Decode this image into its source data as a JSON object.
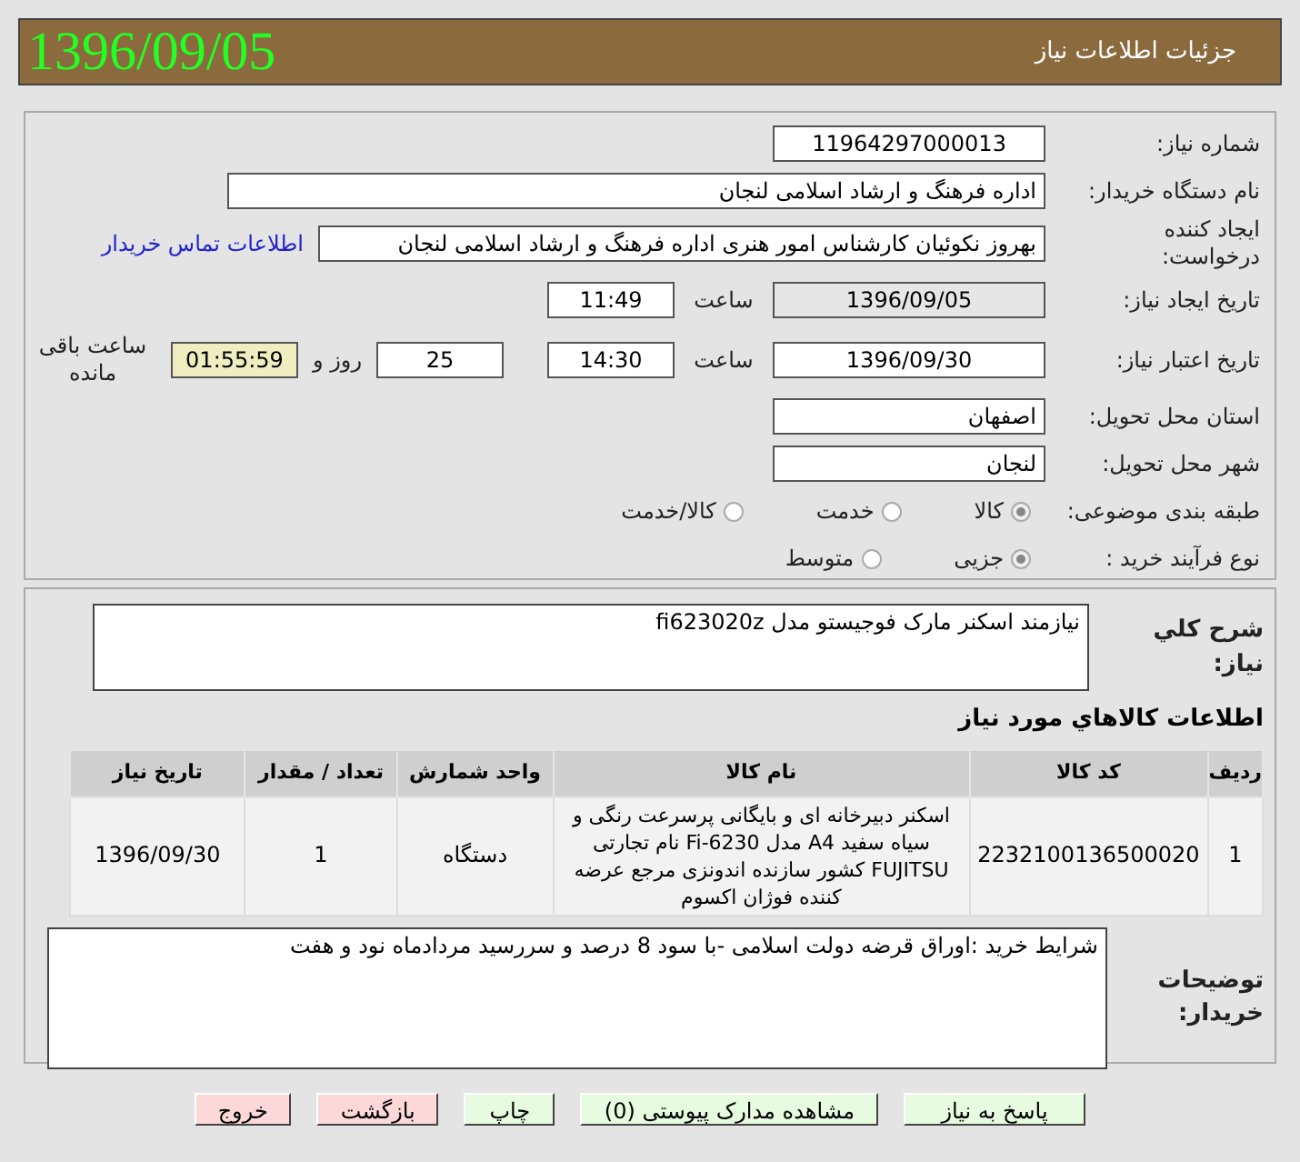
{
  "header": {
    "title": "جزئیات اطلاعات نیاز",
    "date": "1396/09/05"
  },
  "need_number": {
    "label": "شماره نیاز:",
    "value": "11964297000013"
  },
  "buyer": {
    "label": "نام دستگاه خریدار:",
    "value": "اداره فرهنگ و ارشاد اسلامی لنجان"
  },
  "creator": {
    "label": "ایجاد کننده درخواست:",
    "value": "بهروز  نکوئیان  کارشناس امور هنری اداره فرهنگ و ارشاد اسلامی لنجان",
    "link": "اطلاعات تماس خریدار"
  },
  "created": {
    "label": "تاریخ ایجاد نیاز:",
    "date": "1396/09/05",
    "time_label": "ساعت",
    "time": "11:49"
  },
  "validity": {
    "label": "تاریخ اعتبار نیاز:",
    "date": "1396/09/30",
    "time_label": "ساعت",
    "time": "14:30",
    "days": "25",
    "days_label": "روز و",
    "remaining": "01:55:59",
    "remaining_label": "ساعت باقی مانده"
  },
  "province": {
    "label": "استان محل تحویل:",
    "value": "اصفهان"
  },
  "city": {
    "label": "شهر محل تحویل:",
    "value": "لنجان"
  },
  "category": {
    "label": "طبقه بندی موضوعی:",
    "options": [
      {
        "label": "کالا",
        "selected": true
      },
      {
        "label": "خدمت",
        "selected": false
      },
      {
        "label": "کالا/خدمت",
        "selected": false
      }
    ]
  },
  "process": {
    "label": "نوع فرآیند خرید :",
    "options": [
      {
        "label": "جزیی",
        "selected": true
      },
      {
        "label": "متوسط",
        "selected": false
      }
    ]
  },
  "description": {
    "label": "شرح کلي نياز:",
    "value": "نیازمند اسکنر مارک فوجیستو  مدل fi623020z"
  },
  "items_title": "اطلاعات کالاهاي مورد نياز",
  "table": {
    "columns": [
      "رديف",
      "کد کالا",
      "نام کالا",
      "واحد شمارش",
      "تعداد / مقدار",
      "تاریخ نیاز"
    ],
    "rows": [
      [
        "1",
        "2232100136500020",
        "اسکنر دبیرخانه ای و بایگانی پرسرعت رنگی و سیاه سفید A4 مدل Fi-6230 نام تجارتی FUJITSU کشور سازنده اندونزی مرجع عرضه کننده فوژان اکسوم",
        "دستگاه",
        "1",
        "1396/09/30"
      ]
    ]
  },
  "notes": {
    "label": "توضیحات خریدار:",
    "value": "شرایط خرید :اوراق قرضه دولت اسلامی -با سود 8 درصد و سررسید مردادماه نود و هفت"
  },
  "buttons": [
    {
      "label": "پاسخ به نیاز",
      "kind": "normal"
    },
    {
      "label": "مشاهده مدارک پیوستی (0)",
      "kind": "normal"
    },
    {
      "label": "چاپ",
      "kind": "normal"
    },
    {
      "label": "بازگشت",
      "kind": "danger"
    },
    {
      "label": "خروج",
      "kind": "danger"
    }
  ]
}
